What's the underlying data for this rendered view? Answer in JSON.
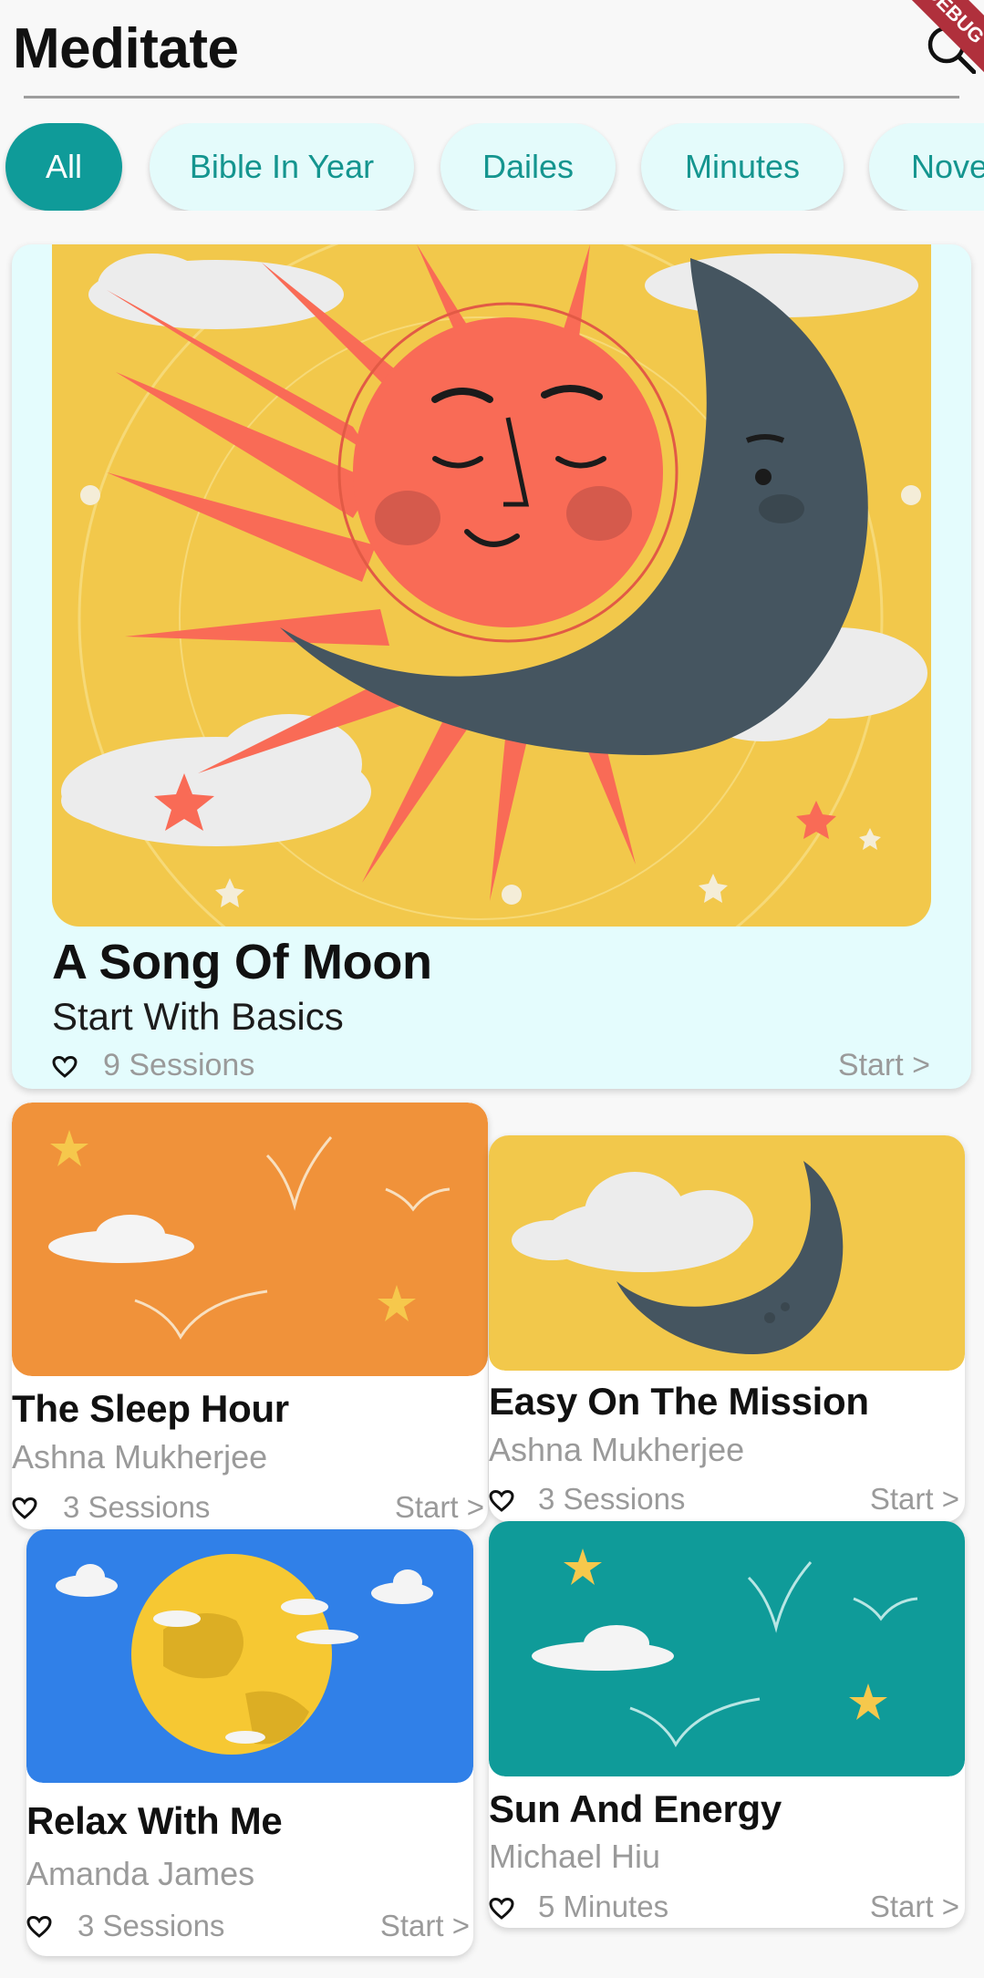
{
  "header": {
    "title": "Meditate",
    "debug_banner": "DEBUG"
  },
  "filters": [
    {
      "label": "All",
      "active": true
    },
    {
      "label": "Bible In Year",
      "active": false
    },
    {
      "label": "Dailes",
      "active": false
    },
    {
      "label": "Minutes",
      "active": false
    },
    {
      "label": "November",
      "active": false
    }
  ],
  "featured": {
    "title": "A Song Of Moon",
    "subtitle": "Start With Basics",
    "sessions": "9 Sessions",
    "action": "Start >"
  },
  "cards": [
    {
      "title": "The Sleep Hour",
      "author": "Ashna Mukherjee",
      "meta": "3 Sessions",
      "action": "Start >",
      "art_color": "#f0923a"
    },
    {
      "title": "Easy On The Mission",
      "author": "Ashna Mukherjee",
      "meta": "3 Sessions",
      "action": "Start >",
      "art_color": "#f2c84b"
    },
    {
      "title": "Relax With Me",
      "author": "Amanda James",
      "meta": "3 Sessions",
      "action": "Start >",
      "art_color": "#3080e8"
    },
    {
      "title": "Sun And Energy",
      "author": "Michael Hiu",
      "meta": "5 Minutes",
      "action": "Start >",
      "art_color": "#0f9b99"
    }
  ],
  "colors": {
    "accent": "#0f9b99",
    "chip_bg": "#e4fbfb",
    "featured_bg": "#e4fcfd"
  }
}
